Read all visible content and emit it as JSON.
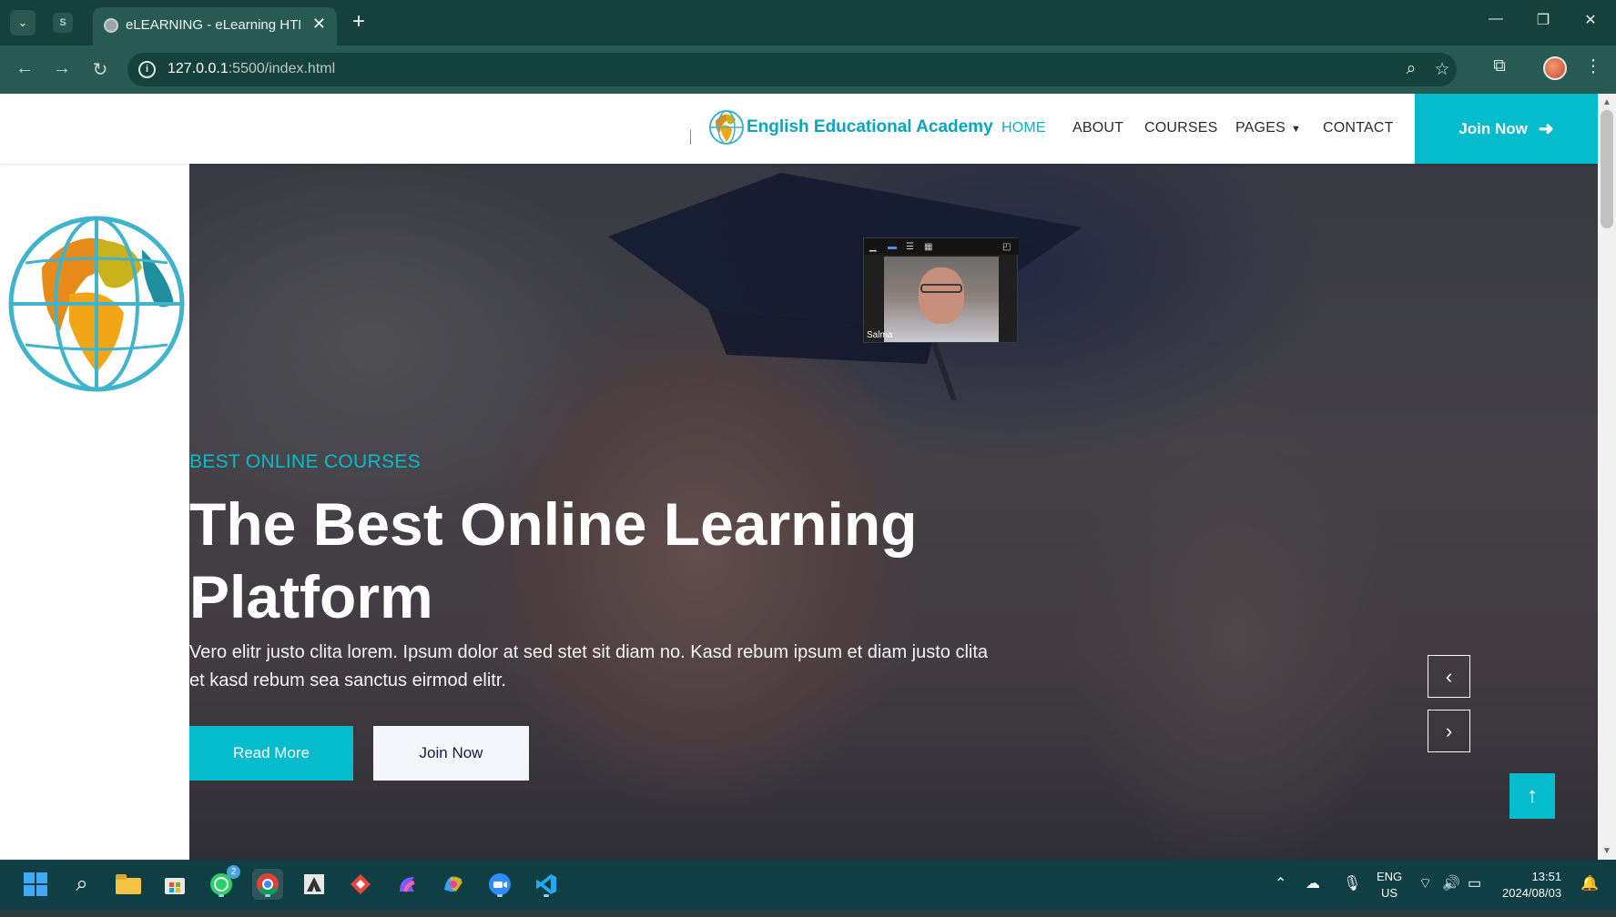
{
  "browser": {
    "tab_title": "eLEARNING - eLearning HTML",
    "url_host": "127.0.0.1",
    "url_path": ":5500/index.html"
  },
  "site": {
    "brand": "English Educational Academy",
    "nav": {
      "home": "HOME",
      "about": "ABOUT",
      "courses": "COURSES",
      "pages": "PAGES",
      "contact": "CONTACT",
      "join": "Join Now"
    },
    "hero": {
      "subtitle": "BEST ONLINE COURSES",
      "title": "The Best Online Learning Platform",
      "description": "Vero elitr justo clita lorem. Ipsum dolor at sed stet sit diam no. Kasd rebum ipsum et diam justo clita et kasd rebum sea sanctus eirmod elitr.",
      "read_more": "Read More",
      "join_now": "Join Now"
    }
  },
  "zoom": {
    "participant_name": "Salma"
  },
  "taskbar": {
    "whatsapp_badge": "2",
    "lang_line1": "ENG",
    "lang_line2": "US",
    "time": "13:51",
    "date": "2024/08/03"
  },
  "colors": {
    "accent": "#06bbcc",
    "dark": "#181d38",
    "chrome": "#275a52"
  }
}
